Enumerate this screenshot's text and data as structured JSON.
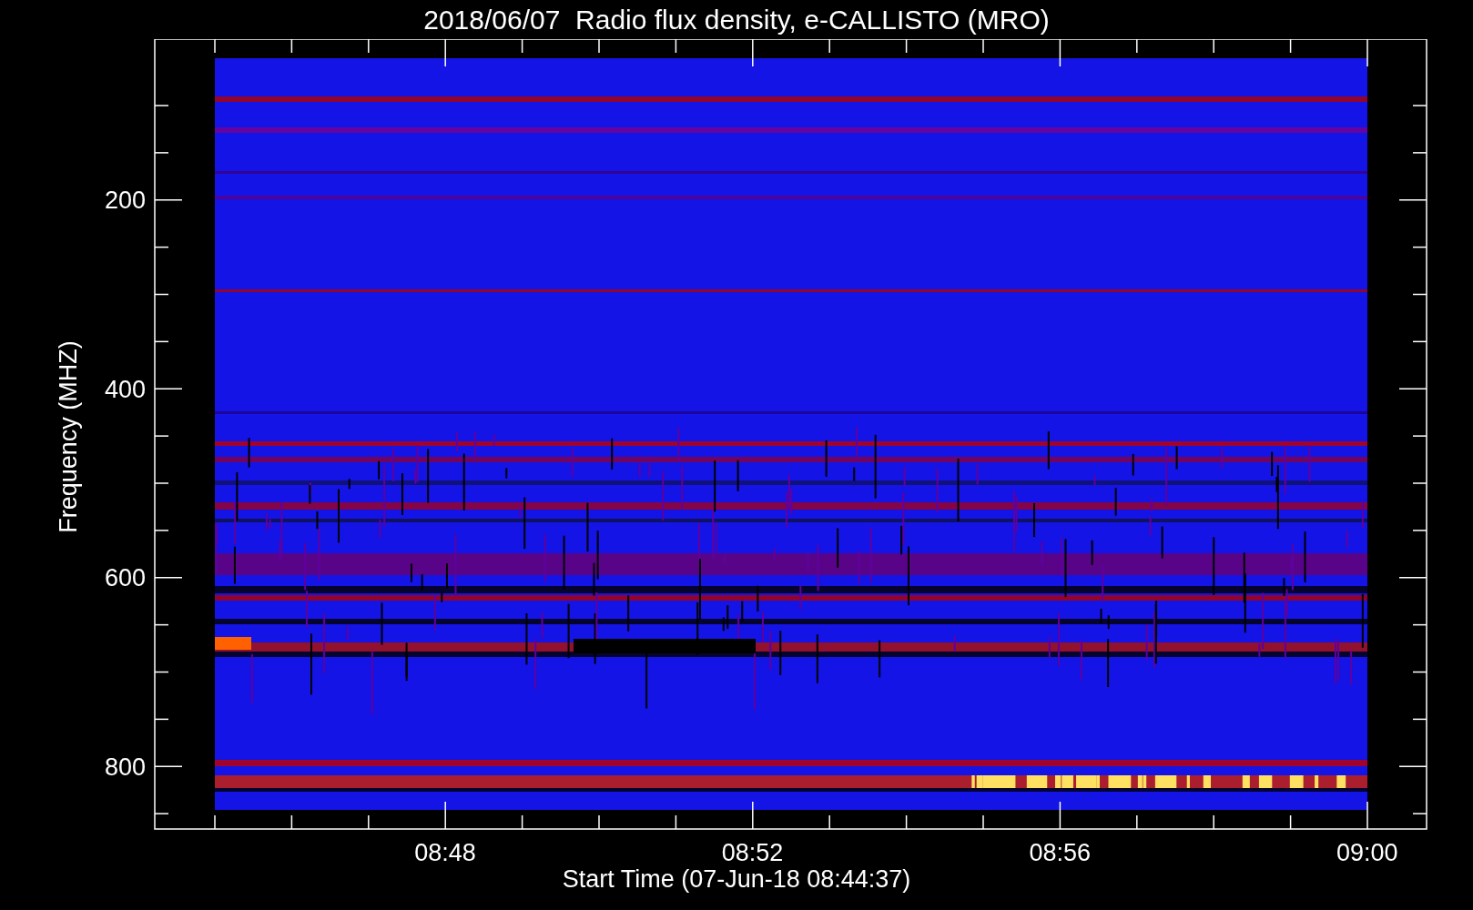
{
  "title": "2018/06/07  Radio flux density, e-CALLISTO (MRO)",
  "y_axis": {
    "label": "Frequency (MHZ)",
    "ticks": [
      "200",
      "400",
      "600",
      "800"
    ]
  },
  "x_axis": {
    "label": "Start Time (07-Jun-18 08:44:37)",
    "ticks": [
      "08:48",
      "08:52",
      "08:56",
      "09:00"
    ]
  }
}
